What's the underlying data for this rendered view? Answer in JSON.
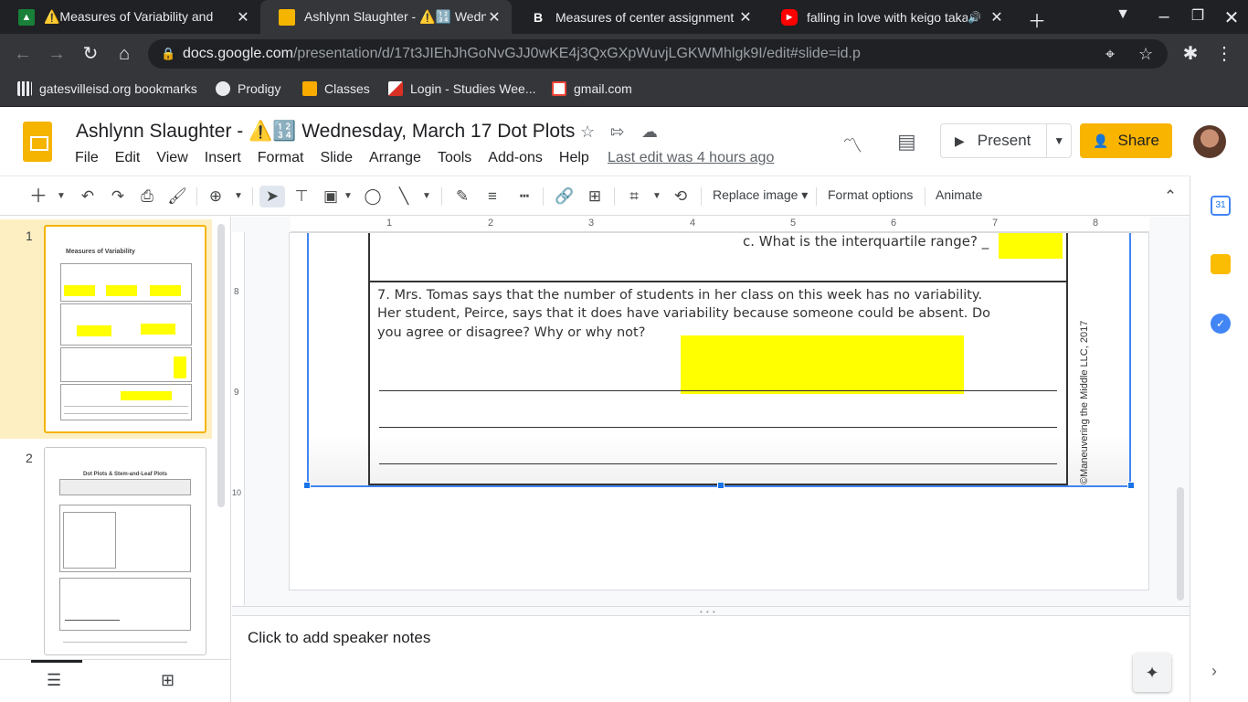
{
  "tabs": [
    {
      "title": "⚠️Measures of Variability and",
      "favicon": "classroom",
      "active": false
    },
    {
      "title": "Ashlynn Slaughter - ⚠️🔢 Wedne",
      "favicon": "slides",
      "active": true
    },
    {
      "title": "Measures of center assignment -",
      "favicon": "b",
      "active": false
    },
    {
      "title": "falling in love with keigo taka",
      "favicon": "youtube",
      "active": false
    }
  ],
  "address": {
    "domain": "docs.google.com",
    "path": "/presentation/d/17t3JIEhJhGoNvGJJ0wKE4j3QxGXpWuvjLGKWMhlgk9I/edit#slide=id.p"
  },
  "bookmarks": [
    {
      "label": "gatesvilleisd.org bookmarks",
      "icon": "apps-grid-icon"
    },
    {
      "label": "Prodigy",
      "icon": "globe-icon"
    },
    {
      "label": "Classes",
      "icon": "classroom-icon"
    },
    {
      "label": "Login - Studies Wee...",
      "icon": "studies-weekly-icon"
    },
    {
      "label": "gmail.com",
      "icon": "gmail-icon"
    }
  ],
  "doc": {
    "title": "Ashlynn Slaughter - ⚠️🔢 Wednesday, March 17 Dot Plots",
    "menu": [
      "File",
      "Edit",
      "View",
      "Insert",
      "Format",
      "Slide",
      "Arrange",
      "Tools",
      "Add-ons",
      "Help"
    ],
    "last_edit": "Last edit was 4 hours ago",
    "present_label": "Present",
    "share_label": "Share"
  },
  "toolbar": {
    "replace_image": "Replace image",
    "format_options": "Format options",
    "animate": "Animate"
  },
  "filmstrip": {
    "slides": [
      {
        "number": "1",
        "heading": "Measures of Variability"
      },
      {
        "number": "2",
        "heading": "Dot Plots & Stem-and-Leaf Plots"
      }
    ]
  },
  "rulers": {
    "h": [
      "1",
      "2",
      "3",
      "4",
      "5",
      "6",
      "7",
      "8"
    ],
    "v": [
      "8",
      "9",
      "10"
    ]
  },
  "worksheet": {
    "question_c": "c.  What is the interquartile range?  _",
    "q7_line1": "7.  Mrs. Tomas says that the number of students in her class on this week has no variability.",
    "q7_line2": "Her student, Peirce, says that it does have variability because someone could be absent.  Do",
    "q7_line3": "you agree or disagree?  Why or why not?",
    "copyright": "©Maneuvering the Middle LLC, 2017"
  },
  "notes": {
    "placeholder": "Click to add speaker notes"
  },
  "colors": {
    "accent_blue": "#1a73e8",
    "slides_yellow": "#f4b400",
    "highlight": "#ffff00"
  }
}
